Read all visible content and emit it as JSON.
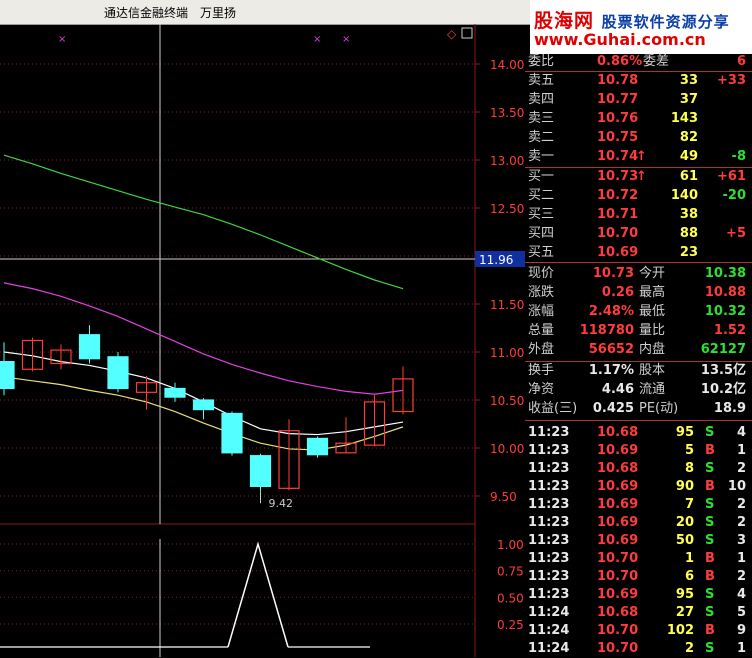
{
  "window": {
    "title": "通达信金融终端",
    "stock_name": "万里扬"
  },
  "logo": {
    "line1": "股海网",
    "line1b": "股票软件资源分享",
    "line2": "www.Guhai.com.cn"
  },
  "price_axis": {
    "ticks": [
      "14.00",
      "13.50",
      "13.00",
      "12.50",
      "12.00",
      "11.50",
      "11.00",
      "10.50",
      "10.00",
      "9.50"
    ],
    "cursor_label": "11.96",
    "low_marker": "9.42"
  },
  "indicator_axis": {
    "ticks": [
      "1.00",
      "0.75",
      "0.50",
      "0.25"
    ]
  },
  "chart_data": [
    {
      "type": "candlestick",
      "candles": [
        {
          "o": 10.9,
          "c": 10.62,
          "h": 11.1,
          "l": 10.55
        },
        {
          "o": 10.82,
          "c": 11.12,
          "h": 11.15,
          "l": 10.8
        },
        {
          "o": 10.88,
          "c": 11.02,
          "h": 11.08,
          "l": 10.82
        },
        {
          "o": 11.18,
          "c": 10.93,
          "h": 11.28,
          "l": 10.88
        },
        {
          "o": 10.95,
          "c": 10.62,
          "h": 11.0,
          "l": 10.58
        },
        {
          "o": 10.58,
          "c": 10.68,
          "h": 10.75,
          "l": 10.4
        },
        {
          "o": 10.62,
          "c": 10.53,
          "h": 10.68,
          "l": 10.48
        },
        {
          "o": 10.5,
          "c": 10.4,
          "h": 10.52,
          "l": 10.3
        },
        {
          "o": 10.36,
          "c": 9.95,
          "h": 10.38,
          "l": 9.92
        },
        {
          "o": 9.92,
          "c": 9.6,
          "h": 9.94,
          "l": 9.55
        },
        {
          "o": 9.58,
          "c": 10.18,
          "h": 10.3,
          "l": 9.56
        },
        {
          "o": 10.1,
          "c": 9.93,
          "h": 10.12,
          "l": 9.9
        },
        {
          "o": 9.95,
          "c": 10.05,
          "h": 10.32,
          "l": 9.95
        },
        {
          "o": 10.03,
          "c": 10.48,
          "h": 10.55,
          "l": 10.02
        },
        {
          "o": 10.38,
          "c": 10.72,
          "h": 10.85,
          "l": 10.35
        }
      ],
      "ma_short": [
        10.74,
        10.7,
        10.66,
        10.6,
        10.55,
        10.48,
        10.38,
        10.26,
        10.15,
        10.05,
        9.99,
        9.98,
        10.03,
        10.12,
        10.22
      ],
      "ma_mid": [
        11.0,
        10.96,
        10.9,
        10.86,
        10.8,
        10.73,
        10.62,
        10.48,
        10.33,
        10.2,
        10.15,
        10.14,
        10.17,
        10.22,
        10.27
      ],
      "ma_long": [
        11.72,
        11.66,
        11.58,
        11.48,
        11.37,
        11.24,
        11.11,
        10.98,
        10.87,
        10.78,
        10.7,
        10.64,
        10.59,
        10.56,
        10.6
      ],
      "ma_top": [
        13.05,
        12.96,
        12.86,
        12.77,
        12.68,
        12.59,
        12.51,
        12.43,
        12.33,
        12.22,
        12.1,
        11.98,
        11.86,
        11.75,
        11.66
      ],
      "ylim": [
        9.25,
        14.2
      ],
      "low_label": "9.42"
    },
    {
      "type": "line",
      "values": [
        0,
        0,
        0,
        0,
        0,
        0,
        0,
        0,
        0,
        0,
        0.0,
        1.0,
        0.0,
        0,
        0
      ],
      "ylim": [
        0,
        1.1
      ]
    }
  ],
  "quotes": {
    "top_row": {
      "label": "委比",
      "value": "0.86%",
      "label2": "委差",
      "value2": "6"
    },
    "sell": [
      {
        "label": "卖五",
        "price": "10.78",
        "vol": "33",
        "chg": "+33",
        "arrow": ""
      },
      {
        "label": "卖四",
        "price": "10.77",
        "vol": "37",
        "chg": "",
        "arrow": ""
      },
      {
        "label": "卖三",
        "price": "10.76",
        "vol": "143",
        "chg": "",
        "arrow": ""
      },
      {
        "label": "卖二",
        "price": "10.75",
        "vol": "82",
        "chg": "",
        "arrow": ""
      },
      {
        "label": "卖一",
        "price": "10.74",
        "vol": "49",
        "chg": "-8",
        "arrow": "↑"
      }
    ],
    "buy": [
      {
        "label": "买一",
        "price": "10.73",
        "vol": "61",
        "chg": "+61",
        "arrow": "↑"
      },
      {
        "label": "买二",
        "price": "10.72",
        "vol": "140",
        "chg": "-20",
        "arrow": ""
      },
      {
        "label": "买三",
        "price": "10.71",
        "vol": "38",
        "chg": "",
        "arrow": ""
      },
      {
        "label": "买四",
        "price": "10.70",
        "vol": "88",
        "chg": "+5",
        "arrow": ""
      },
      {
        "label": "买五",
        "price": "10.69",
        "vol": "23",
        "chg": "",
        "arrow": ""
      }
    ]
  },
  "stats": [
    {
      "l1": "现价",
      "v1": "10.73",
      "l2": "今开",
      "v2": "10.38"
    },
    {
      "l1": "涨跌",
      "v1": "0.26",
      "l2": "最高",
      "v2": "10.88"
    },
    {
      "l1": "涨幅",
      "v1": "2.48%",
      "l2": "最低",
      "v2": "10.32"
    },
    {
      "l1": "总量",
      "v1": "118780",
      "l2": "量比",
      "v2": "1.52"
    },
    {
      "l1": "外盘",
      "v1": "56652",
      "l2": "内盘",
      "v2": "62127"
    }
  ],
  "fund": [
    {
      "l1": "换手",
      "v1": "1.17%",
      "l2": "股本",
      "v2": "13.5亿"
    },
    {
      "l1": "净资",
      "v1": "4.46",
      "l2": "流通",
      "v2": "10.2亿"
    },
    {
      "l1": "收益(三)",
      "v1": "0.425",
      "l2": "PE(动)",
      "v2": "18.9"
    }
  ],
  "ticks": [
    {
      "t": "11:23",
      "p": "10.68",
      "v": "95",
      "s": "S",
      "n": "4"
    },
    {
      "t": "11:23",
      "p": "10.69",
      "v": "5",
      "s": "B",
      "n": "1"
    },
    {
      "t": "11:23",
      "p": "10.68",
      "v": "8",
      "s": "S",
      "n": "2"
    },
    {
      "t": "11:23",
      "p": "10.69",
      "v": "90",
      "s": "B",
      "n": "10"
    },
    {
      "t": "11:23",
      "p": "10.69",
      "v": "7",
      "s": "S",
      "n": "2"
    },
    {
      "t": "11:23",
      "p": "10.69",
      "v": "20",
      "s": "S",
      "n": "2"
    },
    {
      "t": "11:23",
      "p": "10.69",
      "v": "50",
      "s": "S",
      "n": "3"
    },
    {
      "t": "11:23",
      "p": "10.70",
      "v": "1",
      "s": "B",
      "n": "1"
    },
    {
      "t": "11:23",
      "p": "10.70",
      "v": "6",
      "s": "B",
      "n": "2"
    },
    {
      "t": "11:23",
      "p": "10.69",
      "v": "95",
      "s": "S",
      "n": "4"
    },
    {
      "t": "11:24",
      "p": "10.68",
      "v": "27",
      "s": "S",
      "n": "5"
    },
    {
      "t": "11:24",
      "p": "10.70",
      "v": "102",
      "s": "B",
      "n": "9"
    },
    {
      "t": "11:24",
      "p": "10.70",
      "v": "2",
      "s": "S",
      "n": "1"
    }
  ],
  "colors": {
    "up": "#ff3c3c",
    "down": "#54ffff",
    "grid": "#8b1a1a",
    "ma_top": "#3fd43f",
    "ma_long": "#e040e0",
    "ma_mid": "#ffffff",
    "ma_short": "#e8e07a"
  }
}
